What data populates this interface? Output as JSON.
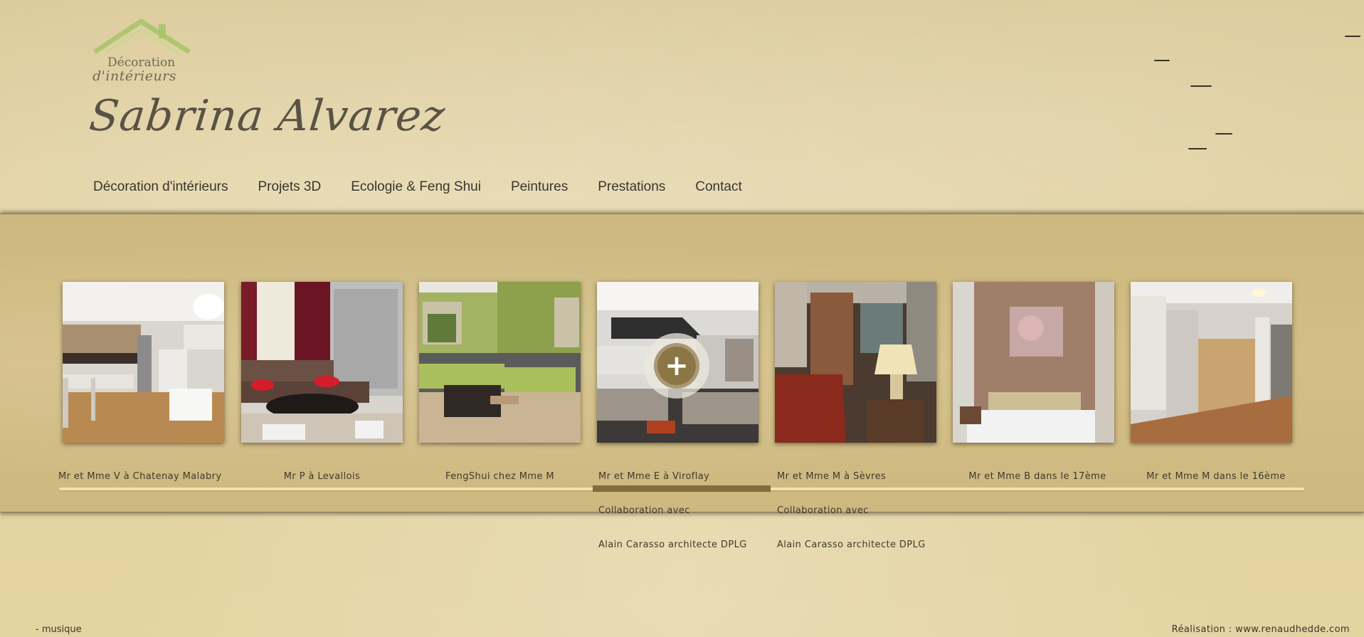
{
  "logo": {
    "line1": "Décoration",
    "line2": "d'intérieurs",
    "icon": "house-roof-icon"
  },
  "site_title": "Sabrina Alvarez",
  "nav": [
    {
      "label": "Décoration d'intérieurs"
    },
    {
      "label": "Projets 3D"
    },
    {
      "label": "Ecologie & Feng Shui"
    },
    {
      "label": "Peintures"
    },
    {
      "label": "Prestations"
    },
    {
      "label": "Contact"
    }
  ],
  "gallery": [
    {
      "caption": [
        "Mr et Mme V à Chatenay Malabry"
      ]
    },
    {
      "caption": [
        "Mr P à Levallois"
      ]
    },
    {
      "caption": [
        "FengShui chez Mme M"
      ]
    },
    {
      "caption": [
        "Mr et Mme E à Viroflay",
        "Collaboration avec",
        "Alain Carasso architecte DPLG"
      ],
      "hover_icon": "plus-icon"
    },
    {
      "caption": [
        "Mr et Mme M à Sèvres",
        "Collaboration avec",
        "Alain Carasso architecte DPLG"
      ]
    },
    {
      "caption": [
        "Mr et Mme B dans le 17ème"
      ]
    },
    {
      "caption": [
        "Mr et Mme M dans le 16ème"
      ]
    }
  ],
  "hover_plus": "+",
  "footer": {
    "music": "- musique",
    "credit": "Réalisation : www.renaudhedde.com"
  },
  "colors": {
    "background": "#e3d3a0",
    "band": "#d0bc83",
    "nav_text": "#3a3328",
    "rail": "#f3e3a9",
    "rail_handle": "#836b3c",
    "logo_green": "#9bbd57"
  }
}
